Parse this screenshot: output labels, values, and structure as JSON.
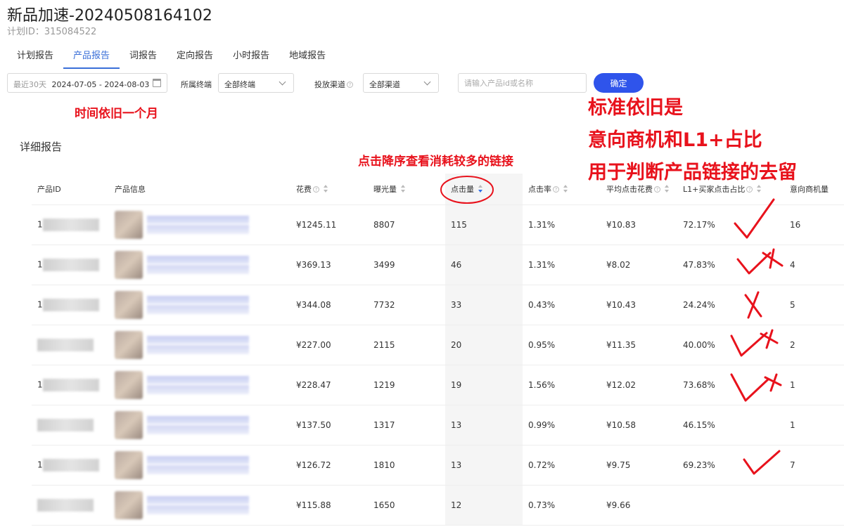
{
  "header": {
    "title": "新品加速-20240508164102",
    "plan_id": "计划ID：315084522"
  },
  "tabs": [
    "计划报告",
    "产品报告",
    "词报告",
    "定向报告",
    "小时报告",
    "地域报告"
  ],
  "filters": {
    "date_prefix": "最近30天",
    "date_range": "2024-07-05 - 2024-08-03",
    "terminal_label": "所属终端",
    "terminal_value": "全部终端",
    "channel_label": "投放渠道",
    "channel_value": "全部渠道",
    "search_placeholder": "请输入产品id或名称",
    "confirm_label": "确定"
  },
  "section_title": "详细报告",
  "table": {
    "columns": [
      "产品ID",
      "产品信息",
      "花费",
      "曝光量",
      "点击量",
      "点击率",
      "平均点击花费",
      "L1+买家点击占比",
      "意向商机量"
    ],
    "rows": [
      {
        "id_prefix": "1",
        "spend": "¥1245.11",
        "impressions": "8807",
        "clicks": "115",
        "ctr": "1.31%",
        "cpc": "¥10.83",
        "l1_ratio": "72.17%",
        "leads": "16"
      },
      {
        "id_prefix": "1",
        "spend": "¥369.13",
        "impressions": "3499",
        "clicks": "46",
        "ctr": "1.31%",
        "cpc": "¥8.02",
        "l1_ratio": "47.83%",
        "leads": "4"
      },
      {
        "id_prefix": "1",
        "spend": "¥344.08",
        "impressions": "7732",
        "clicks": "33",
        "ctr": "0.43%",
        "cpc": "¥10.43",
        "l1_ratio": "24.24%",
        "leads": "5"
      },
      {
        "id_prefix": "",
        "spend": "¥227.00",
        "impressions": "2115",
        "clicks": "20",
        "ctr": "0.95%",
        "cpc": "¥11.35",
        "l1_ratio": "40.00%",
        "leads": "2"
      },
      {
        "id_prefix": "1",
        "spend": "¥228.47",
        "impressions": "1219",
        "clicks": "19",
        "ctr": "1.56%",
        "cpc": "¥12.02",
        "l1_ratio": "73.68%",
        "leads": "1"
      },
      {
        "id_prefix": "",
        "spend": "¥137.50",
        "impressions": "1317",
        "clicks": "13",
        "ctr": "0.99%",
        "cpc": "¥10.58",
        "l1_ratio": "46.15%",
        "leads": "1"
      },
      {
        "id_prefix": "1",
        "spend": "¥126.72",
        "impressions": "1810",
        "clicks": "13",
        "ctr": "0.72%",
        "cpc": "¥9.75",
        "l1_ratio": "69.23%",
        "leads": "7"
      },
      {
        "id_prefix": "",
        "spend": "¥115.88",
        "impressions": "1650",
        "clicks": "12",
        "ctr": "0.73%",
        "cpc": "¥9.66",
        "l1_ratio": "",
        "leads": ""
      }
    ]
  },
  "annotations": {
    "time_note": "时间依旧一个月",
    "click_note": "点击降序查看消耗较多的链接",
    "criteria_line1": "标准依旧是",
    "criteria_line2": "意向商机和L1+占比",
    "criteria_line3": "用于判断产品链接的去留"
  },
  "colors": {
    "accent": "#2f54eb",
    "annotation": "#e8121c",
    "tab_active": "#3a6fd8"
  }
}
